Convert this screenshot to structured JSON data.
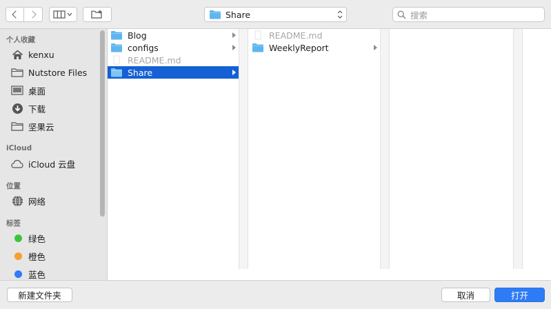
{
  "toolbar": {
    "location": "Share",
    "search_placeholder": "搜索"
  },
  "sidebar": {
    "sections": {
      "favorites": "个人收藏",
      "icloud": "iCloud",
      "locations": "位置",
      "tags": "标签"
    },
    "favorites": [
      {
        "label": "kenxu",
        "icon": "home-icon"
      },
      {
        "label": "Nutstore Files",
        "icon": "folder-icon"
      },
      {
        "label": "桌面",
        "icon": "desktop-icon"
      },
      {
        "label": "下载",
        "icon": "download-icon"
      },
      {
        "label": "坚果云",
        "icon": "folder-icon"
      }
    ],
    "icloud": [
      {
        "label": "iCloud 云盘",
        "icon": "cloud-icon"
      }
    ],
    "locations": [
      {
        "label": "网络",
        "icon": "network-icon"
      }
    ],
    "tags": [
      {
        "label": "绿色",
        "color": "#3cc43c"
      },
      {
        "label": "橙色",
        "color": "#f5a030"
      },
      {
        "label": "蓝色",
        "color": "#2f7cf6"
      }
    ]
  },
  "columns": {
    "col1": [
      {
        "label": "Blog",
        "type": "folder",
        "has_children": true
      },
      {
        "label": "configs",
        "type": "folder",
        "has_children": true
      },
      {
        "label": "README.md",
        "type": "file",
        "disabled": true
      },
      {
        "label": "Share",
        "type": "folder",
        "has_children": true,
        "selected": true
      }
    ],
    "col2": [
      {
        "label": "README.md",
        "type": "file",
        "disabled": true
      },
      {
        "label": "WeeklyReport",
        "type": "folder",
        "has_children": true
      }
    ]
  },
  "footer": {
    "new_folder": "新建文件夹",
    "cancel": "取消",
    "open": "打开"
  },
  "colors": {
    "accent": "#2d7cf6",
    "selection": "#1560d4",
    "folder": "#5fb5f0"
  }
}
